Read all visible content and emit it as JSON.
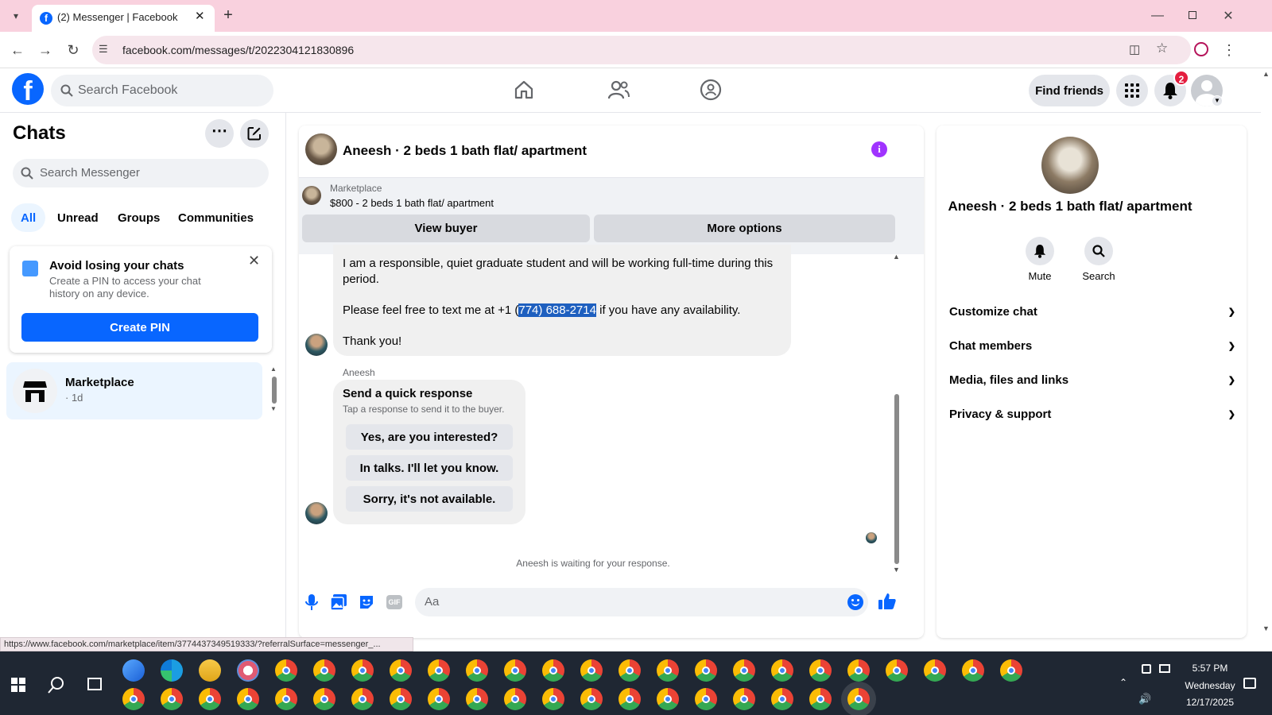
{
  "browser": {
    "tab_title": "(2) Messenger | Facebook",
    "url": "facebook.com/messages/t/2022304121830896",
    "status_url": "https://www.facebook.com/marketplace/item/3774437349519333/?referralSurface=messenger_..."
  },
  "header": {
    "search_placeholder": "Search Facebook",
    "find_friends": "Find friends",
    "notification_count": "2"
  },
  "sidebar": {
    "title": "Chats",
    "search_placeholder": "Search Messenger",
    "filters": [
      "All",
      "Unread",
      "Groups",
      "Communities"
    ],
    "pin_card": {
      "title": "Avoid losing your chats",
      "text": "Create a PIN to access your chat history on any device.",
      "button": "Create PIN"
    },
    "chats": [
      {
        "name": "Marketplace",
        "meta": "· 1d"
      }
    ]
  },
  "conversation": {
    "title": "Aneesh · 2 beds 1 bath flat/ apartment",
    "marketplace": {
      "label": "Marketplace",
      "listing": "$800 - 2 beds 1 bath flat/ apartment",
      "view_buyer": "View buyer",
      "more_options": "More options"
    },
    "message": {
      "line1": "I am a responsible, quiet graduate student and will be working full-time during this",
      "line2": "period.",
      "contact_prefix": "Please feel free to text me at +1 (",
      "phone_selected": "774) 688-2714",
      "contact_suffix": " if you have any availability.",
      "thanks": "Thank you!"
    },
    "sender_name": "Aneesh",
    "quick_response": {
      "title": "Send a quick response",
      "subtitle": "Tap a response to send it to the buyer.",
      "options": [
        "Yes, are you interested?",
        "In talks. I'll let you know.",
        "Sorry, it's not available."
      ]
    },
    "waiting": "Aneesh is waiting for your response.",
    "composer_placeholder": "Aa"
  },
  "details": {
    "title": "Aneesh · 2 beds 1 bath flat/ apartment",
    "actions": [
      {
        "label": "Mute"
      },
      {
        "label": "Search"
      }
    ],
    "sections": [
      "Customize chat",
      "Chat members",
      "Media, files and links",
      "Privacy & support"
    ]
  },
  "taskbar": {
    "time": "5:57 PM",
    "day": "Wednesday",
    "date": "12/17/2025"
  },
  "colors": {
    "fb_blue": "#0866ff",
    "tab_bar": "#f9d1de",
    "info_purple": "#a033ff",
    "taskbar": "#1f2733"
  }
}
